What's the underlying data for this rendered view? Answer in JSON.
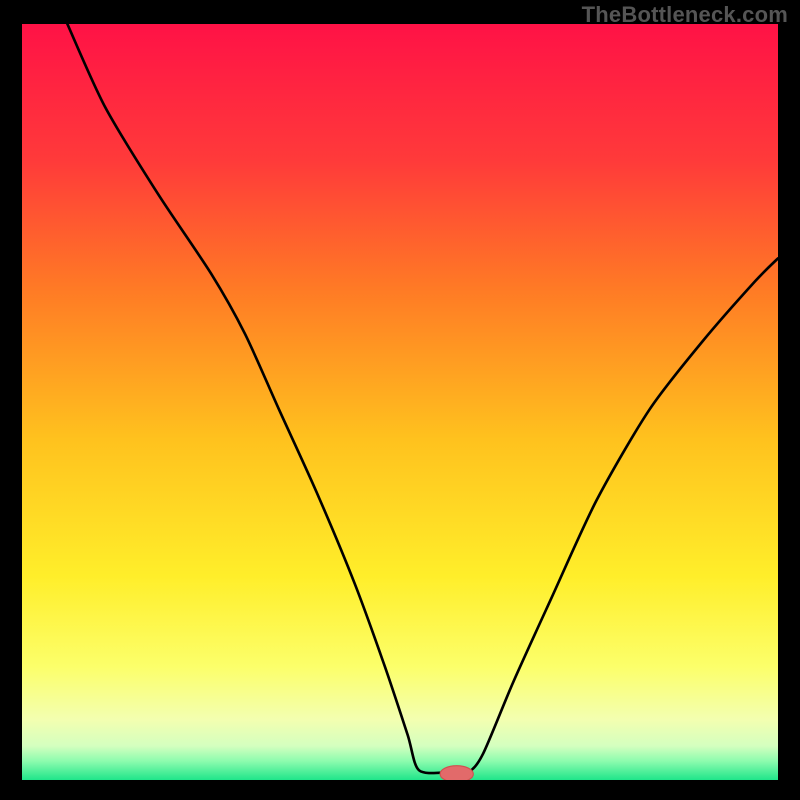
{
  "watermark": "TheBottleneck.com",
  "colors": {
    "background": "#000000",
    "curve": "#000000",
    "marker_fill": "#e26a6a",
    "marker_stroke": "#d14f4f"
  },
  "chart_data": {
    "type": "line",
    "title": "",
    "xlabel": "",
    "ylabel": "",
    "xlim": [
      0,
      100
    ],
    "ylim": [
      0,
      100
    ],
    "gradient_stops": [
      {
        "offset": 0.0,
        "color": "#ff1246"
      },
      {
        "offset": 0.18,
        "color": "#ff3a3a"
      },
      {
        "offset": 0.35,
        "color": "#ff7a25"
      },
      {
        "offset": 0.55,
        "color": "#ffc21e"
      },
      {
        "offset": 0.73,
        "color": "#ffee2a"
      },
      {
        "offset": 0.85,
        "color": "#fcff6a"
      },
      {
        "offset": 0.92,
        "color": "#f3ffb0"
      },
      {
        "offset": 0.955,
        "color": "#d4ffbf"
      },
      {
        "offset": 0.975,
        "color": "#8dfcae"
      },
      {
        "offset": 1.0,
        "color": "#1fe58a"
      }
    ],
    "series": [
      {
        "name": "bottleneck-curve",
        "points": [
          {
            "x": 6.0,
            "y": 100.0
          },
          {
            "x": 11.0,
            "y": 89.0
          },
          {
            "x": 18.0,
            "y": 77.5
          },
          {
            "x": 25.0,
            "y": 67.0
          },
          {
            "x": 29.5,
            "y": 59.0
          },
          {
            "x": 34.0,
            "y": 49.0
          },
          {
            "x": 39.0,
            "y": 38.0
          },
          {
            "x": 44.0,
            "y": 26.0
          },
          {
            "x": 48.0,
            "y": 15.0
          },
          {
            "x": 51.0,
            "y": 6.0
          },
          {
            "x": 52.5,
            "y": 1.3
          },
          {
            "x": 56.5,
            "y": 1.0
          },
          {
            "x": 59.0,
            "y": 1.0
          },
          {
            "x": 61.0,
            "y": 3.5
          },
          {
            "x": 65.0,
            "y": 13.0
          },
          {
            "x": 70.0,
            "y": 24.0
          },
          {
            "x": 76.0,
            "y": 37.0
          },
          {
            "x": 83.0,
            "y": 49.0
          },
          {
            "x": 90.0,
            "y": 58.0
          },
          {
            "x": 97.0,
            "y": 66.0
          },
          {
            "x": 100.0,
            "y": 69.0
          }
        ]
      }
    ],
    "marker": {
      "x": 57.5,
      "y": 0.8,
      "rx": 2.2,
      "ry": 1.1
    }
  }
}
